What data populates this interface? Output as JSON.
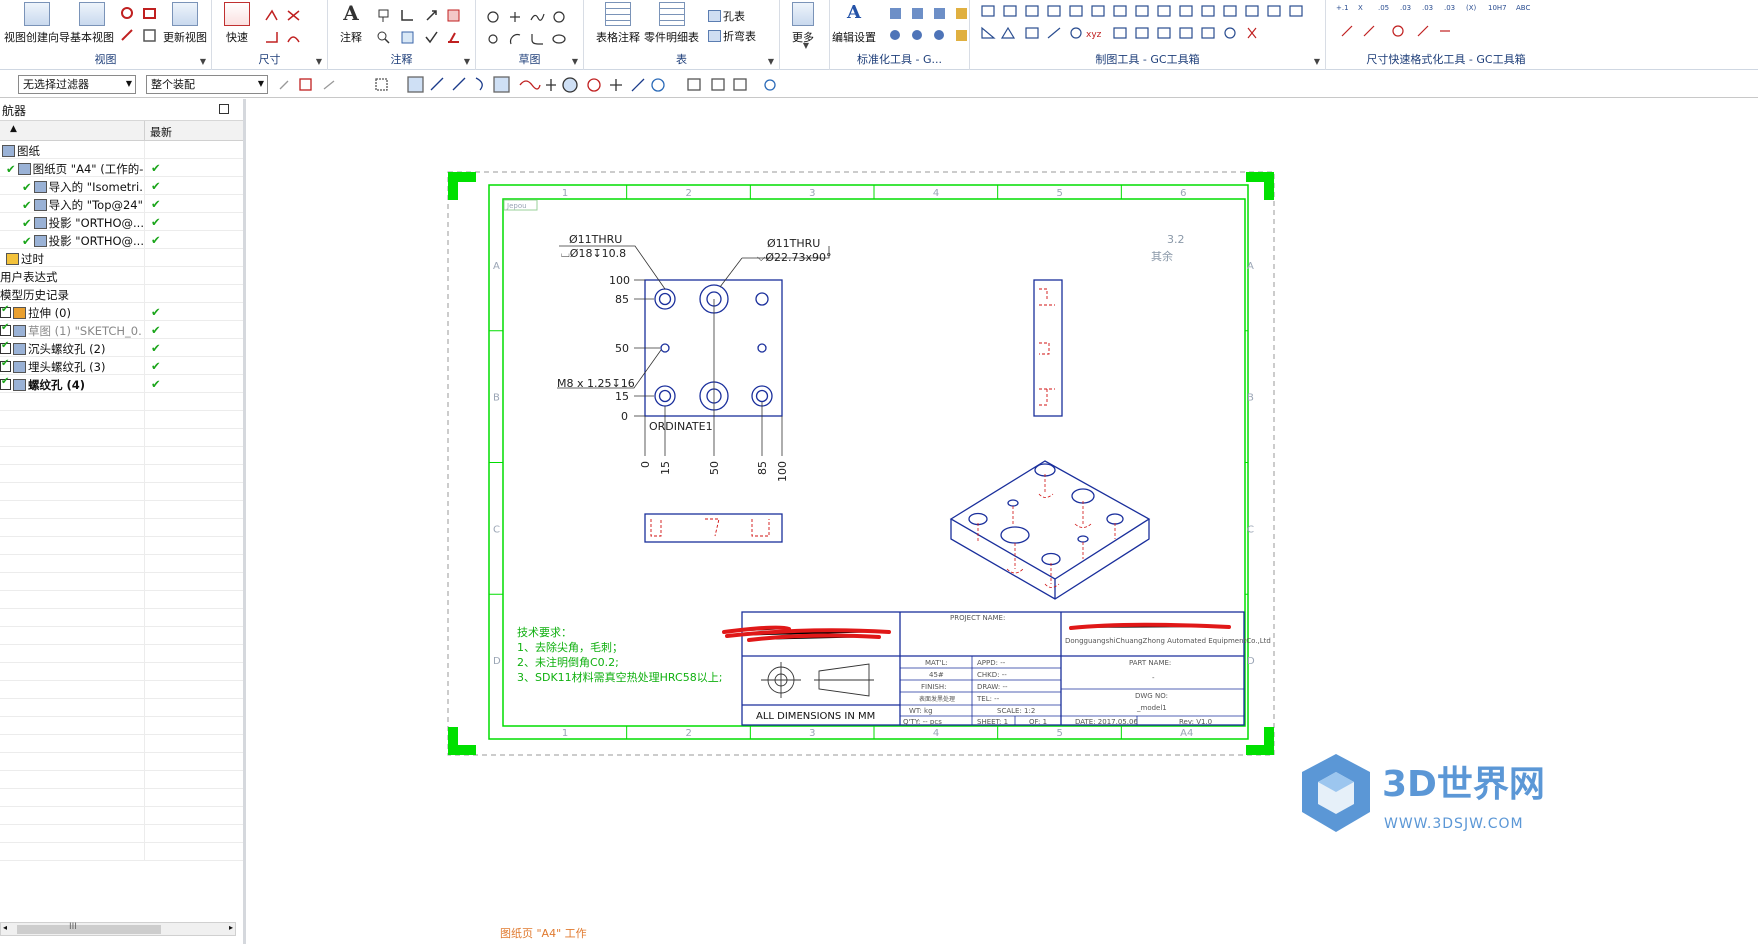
{
  "ribbon": {
    "groups": [
      {
        "name": "视图",
        "buttons": [
          "视图创建向导",
          "基本视图",
          "更新视图"
        ]
      },
      {
        "name": "尺寸",
        "buttons": [
          "快速"
        ]
      },
      {
        "name": "注释",
        "buttons": [
          "注释"
        ]
      },
      {
        "name": "草图",
        "buttons": []
      },
      {
        "name": "表",
        "buttons": [
          "表格注释",
          "零件明细表",
          "孔表",
          "折弯表"
        ]
      },
      {
        "name": "",
        "buttons": [
          "更多"
        ]
      },
      {
        "name": "标准化工具 - G...",
        "buttons": [
          "编辑设置"
        ]
      },
      {
        "name": "制图工具 - GC工具箱",
        "buttons": []
      },
      {
        "name": "尺寸快速格式化工具 - GC工具箱",
        "buttons": []
      }
    ]
  },
  "toolbar": {
    "filter": "无选择过滤器",
    "scope": "整个装配"
  },
  "navigator": {
    "title": "航器",
    "col_latest": "最新",
    "rows": [
      {
        "label": "图纸",
        "check": ""
      },
      {
        "label": "图纸页 \"A4\" (工作的-...",
        "check": "✔"
      },
      {
        "label": "导入的 \"Isometri...",
        "check": "✔"
      },
      {
        "label": "导入的 \"Top@24\"",
        "check": "✔"
      },
      {
        "label": "投影 \"ORTHO@...",
        "check": "✔"
      },
      {
        "label": "投影 \"ORTHO@...",
        "check": "✔"
      },
      {
        "label": "过时",
        "check": ""
      },
      {
        "label": "用户表达式",
        "check": ""
      },
      {
        "label": "模型历史记录",
        "check": ""
      },
      {
        "label": "拉伸 (0)",
        "check": "✔"
      },
      {
        "label": "草图 (1) \"SKETCH_0...",
        "check": "✔"
      },
      {
        "label": "沉头螺纹孔 (2)",
        "check": "✔"
      },
      {
        "label": "埋头螺纹孔 (3)",
        "check": "✔"
      },
      {
        "label": "螺纹孔 (4)",
        "check": "✔"
      }
    ],
    "scroll_label": "III"
  },
  "drawing": {
    "col_numbers": [
      "1",
      "2",
      "3",
      "4",
      "5",
      "6"
    ],
    "col_numbers_bottom": [
      "1",
      "2",
      "3",
      "4",
      "5",
      "A4"
    ],
    "row_letters": [
      "A",
      "B",
      "C",
      "D"
    ],
    "corner_tag": "Jepou",
    "callout1_a": "Ø11THRU",
    "callout1_b": "⌴Ø18↧10.8",
    "callout2_a": "Ø11THRU",
    "callout2_b": "⌵Ø22.73x90°",
    "callout3": "M8 x 1.25↧16",
    "ordinate_label": "ORDINATE1",
    "y_ticks": [
      "100",
      "85",
      "50",
      "15",
      "0"
    ],
    "x_ticks": [
      "0",
      "15",
      "50",
      "85",
      "100"
    ],
    "roughness_value": "3.2",
    "roughness_text": "其余",
    "tech_title": "技术要求：",
    "tech_items": [
      "1、去除尖角，毛刺；",
      "2、未注明倒角C0.2;",
      "3、SDK11材料需真空热处理HRC58以上;"
    ],
    "tb": {
      "project_name": "PROJECT NAME:",
      "company_en": "DongguangshiChuangZhong Automated EquipmentCo.,Ltd",
      "part_name": "PART NAME:",
      "part_value": "-",
      "matl": "MAT'L:",
      "matl_val": "45#",
      "appd": "APPD: --",
      "chkd": "CHKD: --",
      "finish": "FINISH:",
      "finish_val": "表面发黑处理",
      "draw": "DRAW: --",
      "tel": "TEL: --",
      "dwg_no": "DWG NO:",
      "dwg_val": "_model1",
      "wt": "WT:  kg",
      "scale": "SCALE: 1:2",
      "qty": "Q'TY:  -- pcs",
      "sheet": "SHEET: 1",
      "of": "OF: 1",
      "date": "DATE: 2017.05.06",
      "rev": "Rev: V1.0",
      "all_dims": "ALL DIMENSIONS IN MM"
    }
  },
  "status_text": "图纸页 \"A4\" 工作",
  "watermark": {
    "brand": "3D世界网",
    "url": "WWW.3DSJW.COM"
  },
  "colors": {
    "accent_green": "#00e000",
    "drawing_blue": "#1a2f9c",
    "red_hidden": "#d01010"
  }
}
